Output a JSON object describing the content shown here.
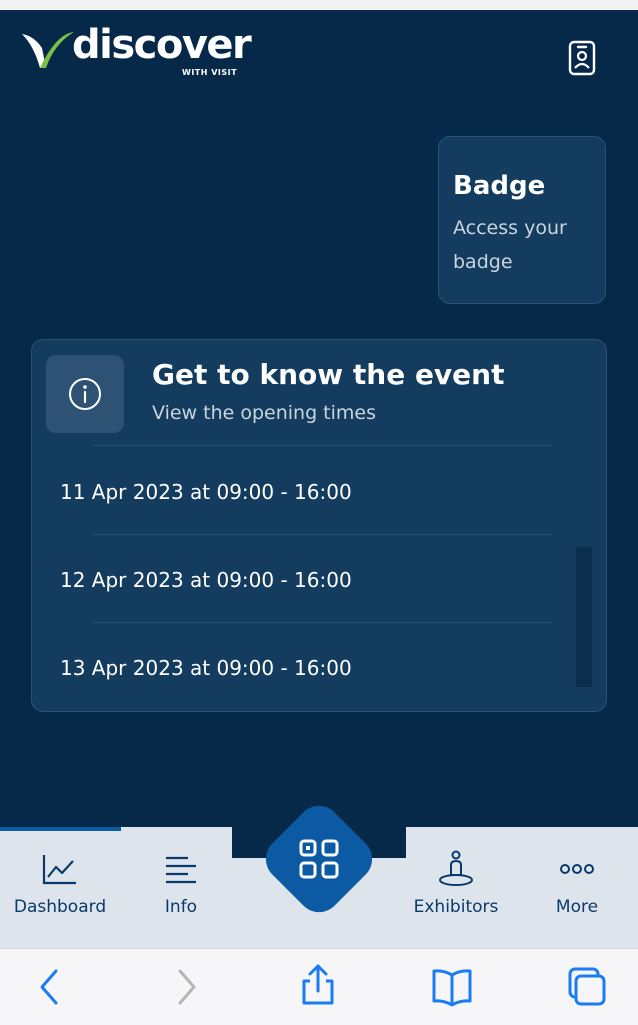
{
  "header": {
    "logo_text": "discover",
    "logo_subtext": "WITH VISIT",
    "badge_button_icon": "id-badge-icon"
  },
  "badge_card": {
    "title": "Badge",
    "subtitle": "Access your badge"
  },
  "event_card": {
    "icon": "info-icon",
    "title": "Get to know the event",
    "subtitle": "View the opening times",
    "times": [
      "11 Apr 2023 at 09:00 - 16:00",
      "12 Apr 2023 at 09:00 - 16:00",
      "13 Apr 2023 at 09:00 - 16:00"
    ]
  },
  "tabbar": {
    "active": "Dashboard",
    "tabs": [
      {
        "label": "Dashboard",
        "icon": "chart-line-icon"
      },
      {
        "label": "Info",
        "icon": "lines-icon"
      },
      {
        "label": "Exhibitors",
        "icon": "map-pin-person-icon"
      },
      {
        "label": "More",
        "icon": "more-dots-icon"
      }
    ],
    "center_button_icon": "qr-code-icon"
  },
  "browser_toolbar": {
    "icons": [
      "back-icon",
      "forward-icon",
      "share-icon",
      "bookmarks-icon",
      "tabs-icon"
    ]
  },
  "colors": {
    "background": "#06294a",
    "card": "#143c5f",
    "accent": "#0b5aa3",
    "tabbar": "#dde4ec"
  }
}
